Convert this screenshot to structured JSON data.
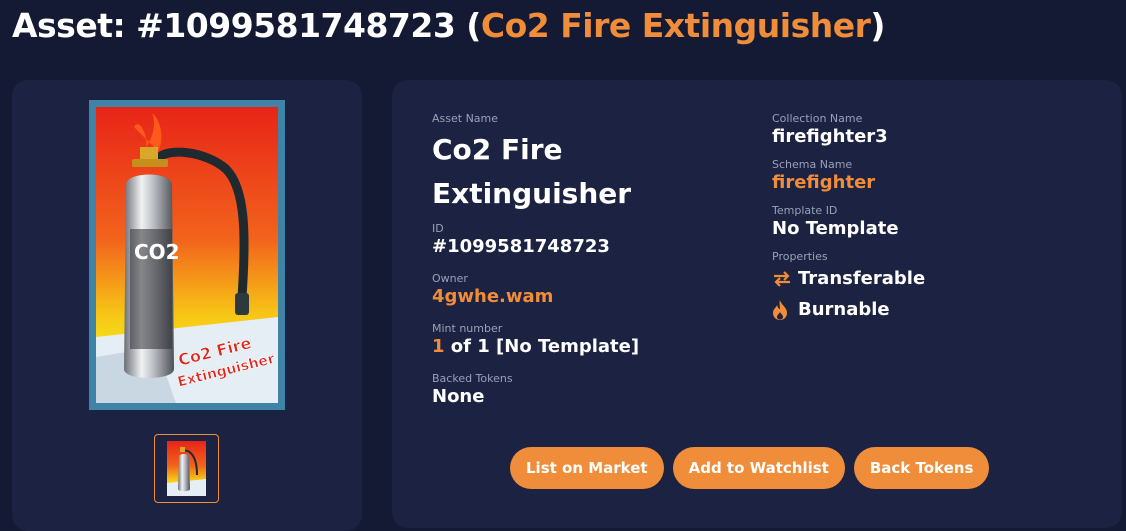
{
  "header": {
    "title_prefix": "Asset: #1099581748723 (",
    "title_name": "Co2 Fire Extinguisher",
    "title_suffix": ")"
  },
  "details": {
    "asset_name_label": "Asset Name",
    "asset_name": "Co2 Fire Extinguisher",
    "id_label": "ID",
    "id": "#1099581748723",
    "owner_label": "Owner",
    "owner": "4gwhe.wam",
    "mint_label": "Mint number",
    "mint_number": "1",
    "mint_rest": " of 1 [No Template]",
    "backed_label": "Backed Tokens",
    "backed": "None",
    "collection_label": "Collection Name",
    "collection": "firefighter3",
    "schema_label": "Schema Name",
    "schema": "firefighter",
    "template_label": "Template ID",
    "template": "No Template",
    "properties_label": "Properties",
    "properties": [
      {
        "label": "Transferable",
        "icon": "transfer-arrows-icon"
      },
      {
        "label": "Burnable",
        "icon": "flame-icon"
      }
    ]
  },
  "image": {
    "card_text_line1": "Co2 Fire",
    "card_text_line2": "Extinguisher",
    "co2_text": "CO2"
  },
  "actions": {
    "list": "List on Market",
    "watchlist": "Add to Watchlist",
    "back": "Back Tokens"
  },
  "colors": {
    "accent": "#f08d3a",
    "background": "#141a33",
    "card": "#1c2241"
  }
}
